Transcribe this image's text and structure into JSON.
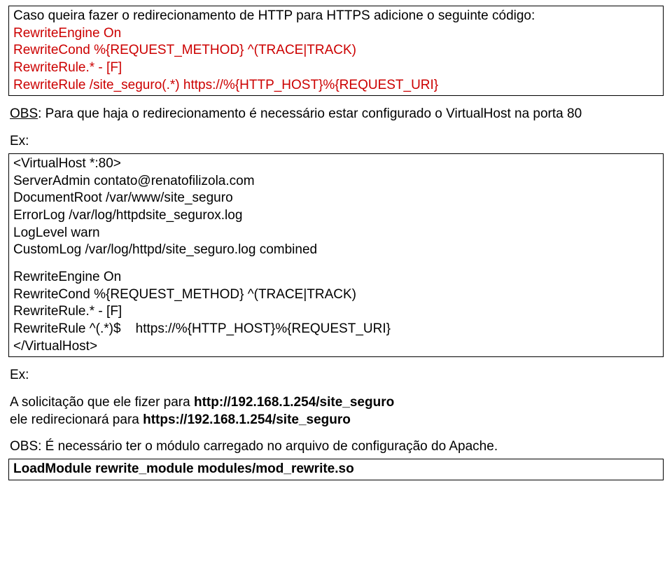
{
  "box1": {
    "line1": "Caso queira fazer o redirecionamento de HTTP para HTTPS adicione o seguinte código:",
    "red1": "RewriteEngine On",
    "red2": "RewriteCond %{REQUEST_METHOD} ^(TRACE|TRACK)",
    "red3": "RewriteRule.* - [F]",
    "red4": "RewriteRule /site_seguro(.*) https://%{HTTP_HOST}%{REQUEST_URI}"
  },
  "obs1": {
    "label": "OBS",
    "text": ": Para que haja o redirecionamento é necessário estar configurado o VirtualHost na porta 80"
  },
  "ex1": "Ex:",
  "config": {
    "l1": "<VirtualHost *:80>",
    "l2": "ServerAdmin contato@renatofilizola.com",
    "l3": "DocumentRoot /var/www/site_seguro",
    "l4": "ErrorLog /var/log/httpdsite_segurox.log",
    "l5": "LogLevel warn",
    "l6": "CustomLog /var/log/httpd/site_seguro.log combined",
    "l7": "RewriteEngine On",
    "l8": "RewriteCond %{REQUEST_METHOD} ^(TRACE|TRACK)",
    "l9": "RewriteRule.* - [F]",
    "l10": "RewriteRule ^(.*)$    https://%{HTTP_HOST}%{REQUEST_URI}",
    "l11": "</VirtualHost>"
  },
  "ex2": "Ex:",
  "req": {
    "p1a": "A solicitação que ele fizer para ",
    "p1b": "http://192.168.1.254/site_seguro",
    "p2a": "ele redirecionará para ",
    "p2b": "https://192.168.1.254/site_seguro"
  },
  "obs2": "OBS: É necessário ter o módulo carregado no arquivo de configuração do Apache.",
  "load": "LoadModule rewrite_module modules/mod_rewrite.so"
}
